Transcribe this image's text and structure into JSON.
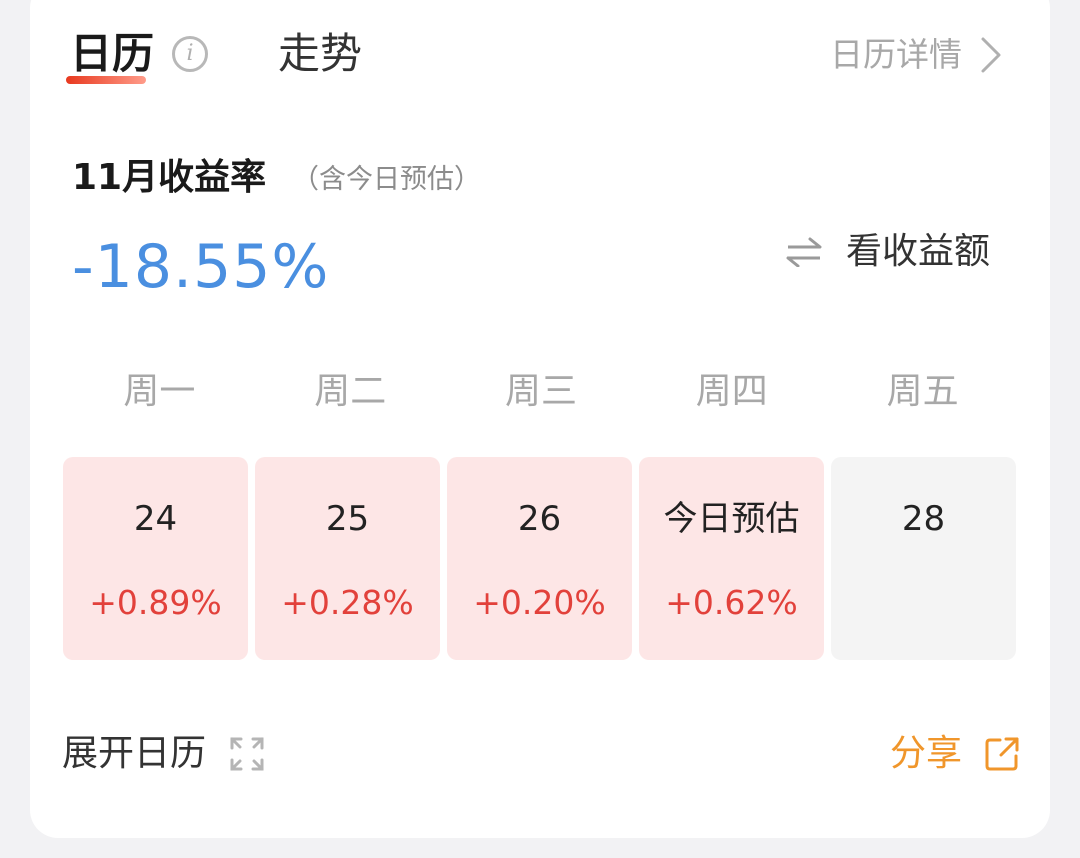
{
  "tabs": {
    "calendar_label": "日历",
    "trend_label": "走势"
  },
  "header": {
    "detail_label": "日历详情",
    "info_icon": "info-icon",
    "detail_icon": "chevron-right-icon"
  },
  "summary": {
    "title": "11月收益率",
    "subtitle": "（含今日预估）",
    "rate": "-18.55%",
    "switch_label": "看收益额",
    "switch_icon": "swap-arrows-icon"
  },
  "weekdays": [
    "周一",
    "周二",
    "周三",
    "周四",
    "周五"
  ],
  "days": [
    {
      "label": "24",
      "rate": "+0.89%",
      "status": "up"
    },
    {
      "label": "25",
      "rate": "+0.28%",
      "status": "up"
    },
    {
      "label": "26",
      "rate": "+0.20%",
      "status": "up"
    },
    {
      "label": "今日预估",
      "rate": "+0.62%",
      "status": "up"
    },
    {
      "label": "28",
      "rate": "",
      "status": "none"
    }
  ],
  "footer": {
    "expand_label": "展开日历",
    "expand_icon": "expand-icon",
    "share_label": "分享",
    "share_icon": "share-icon"
  },
  "colors": {
    "negative_rate": "#4a8fe0",
    "positive_rate": "#e2413b",
    "accent": "#f0962b",
    "up_cell_bg": "#fde6e6",
    "empty_cell_bg": "#f4f4f4"
  }
}
